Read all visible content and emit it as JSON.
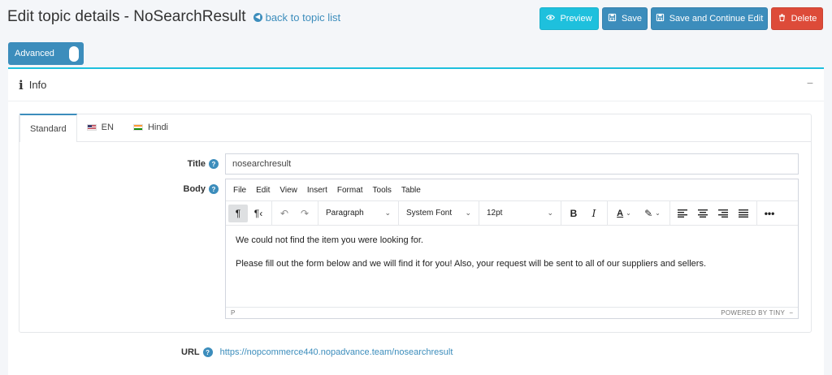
{
  "header": {
    "title": "Edit topic details - NoSearchResult",
    "back_link": "back to topic list"
  },
  "buttons": {
    "preview": "Preview",
    "save": "Save",
    "save_continue": "Save and Continue Edit",
    "delete": "Delete"
  },
  "advanced_toggle": {
    "label": "Advanced",
    "state": "on"
  },
  "card": {
    "title": "Info",
    "collapse_symbol": "−"
  },
  "tabs": [
    {
      "label": "Standard",
      "active": true
    },
    {
      "label": "EN",
      "flag": "us-flag"
    },
    {
      "label": "Hindi",
      "flag": "india-flag"
    }
  ],
  "form": {
    "title_label": "Title",
    "title_value": "nosearchresult",
    "body_label": "Body",
    "url_label": "URL",
    "url_value": "https://nopcommerce440.nopadvance.team/nosearchresult"
  },
  "editor": {
    "menu": [
      "File",
      "Edit",
      "View",
      "Insert",
      "Format",
      "Tools",
      "Table"
    ],
    "block_format": "Paragraph",
    "font_family": "System Font",
    "font_size": "12pt",
    "bold": "B",
    "italic": "I",
    "content": [
      "We could not find the item you were looking for.",
      "Please fill out the form below and we will find it for you! Also, your request will be sent to all of our suppliers and sellers."
    ],
    "status_path": "P",
    "powered_by": "POWERED BY TINY"
  },
  "colors": {
    "primary": "#3c8dbc",
    "info": "#1ec0dd",
    "danger": "#dd4b39"
  }
}
